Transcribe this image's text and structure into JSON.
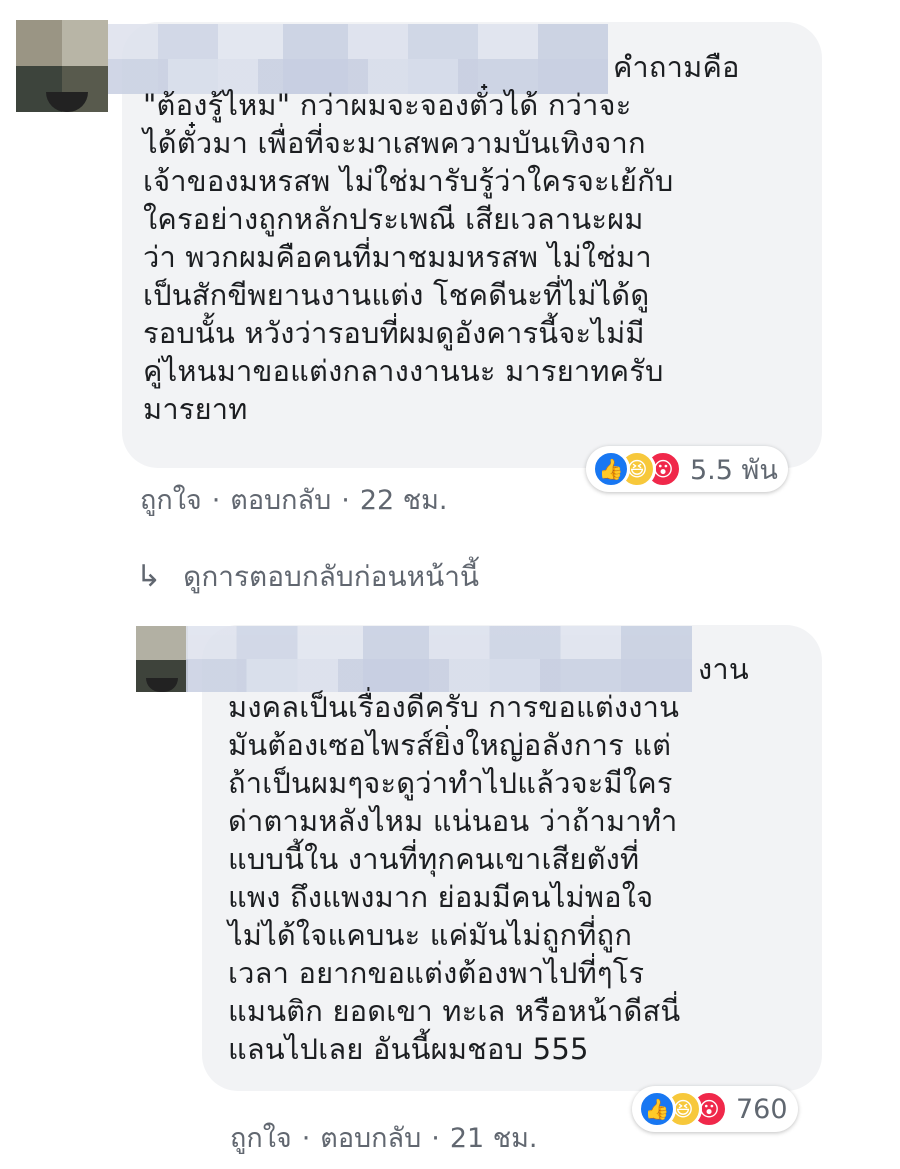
{
  "comments": [
    {
      "text_lines": [
        "คำถามคือ",
        "\"ต้องรู้ไหม\" กว่าผมจะจองตั๋วได้ กว่าจะ",
        "ได้ตั๋วมา เพื่อที่จะมาเสพความบันเทิงจาก",
        "เจ้าของมหรสพ ไม่ใช่มารับรู้ว่าใครจะเย้กับ",
        "ใครอย่างถูกหลักประเพณี เสียเวลานะผม",
        "ว่า พวกผมคือคนที่มาชมมหรสพ ไม่ใช่มา",
        "เป็นสักขีพยานงานแต่ง โชคดีนะที่ไม่ได้ดู",
        "รอบนั้น หวังว่ารอบที่ผมดูอังคารนี้จะไม่มี",
        "คู่ไหนมาขอแต่งกลางงานนะ มารยาทครับ",
        "มารยาท"
      ],
      "reaction_count": "5.5 พัน",
      "reactions": [
        "like-icon",
        "haha-icon",
        "wow-icon"
      ],
      "actions": {
        "like": "ถูกใจ",
        "sep": "·",
        "reply": "ตอบกลับ",
        "time": "22 ชม."
      }
    },
    {
      "text_lines": [
        "งาน",
        "มงคลเป็นเรื่องดีครับ การขอแต่งงาน",
        "มันต้องเซอไพรส์ยิ่งใหญ่อลังการ แต่",
        "ถ้าเป็นผมๆจะดูว่าทำไปแล้วจะมีใคร",
        "ด่าตามหลังไหม แน่นอน ว่าถ้ามาทำ",
        "แบบนี้ใน งานที่ทุกคนเขาเสียตังที่",
        "แพง ถึงแพงมาก ย่อมมีคนไม่พอใจ",
        "ไม่ได้ใจแคบนะ แค่มันไม่ถูกที่ถูก",
        "เวลา อยากขอแต่งต้องพาไปที่ๆโร",
        "แมนติก ยอดเขา ทะเล หรือหน้าดีสนี่",
        "แลนไปเลย อันนี้ผมชอบ 555"
      ],
      "reaction_count": "760",
      "reactions": [
        "like-icon",
        "haha-icon",
        "wow-icon"
      ],
      "actions": {
        "like": "ถูกใจ",
        "sep": "·",
        "reply": "ตอบกลับ",
        "time": "21 ชม."
      }
    }
  ],
  "view_previous": "ดูการตอบกลับก่อนหน้านี้",
  "colors": {
    "bubble": "#f2f3f5",
    "text": "#1c1e21",
    "meta": "#616770",
    "like": "#1877f2",
    "haha": "#f7c83b",
    "wow": "#f0284a"
  }
}
